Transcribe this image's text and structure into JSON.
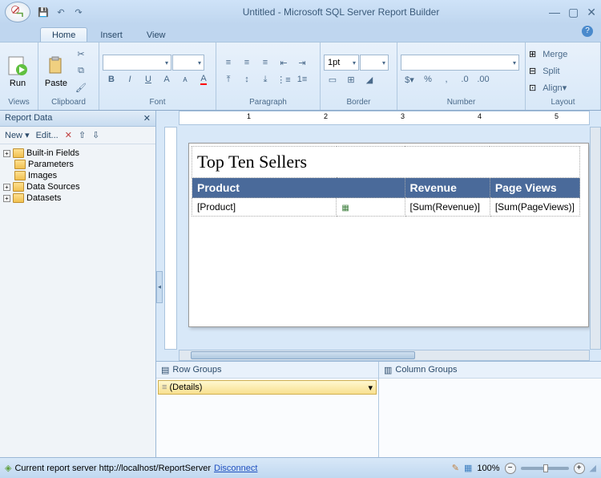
{
  "title": "Untitled - Microsoft SQL Server Report Builder",
  "qat": {
    "save": "💾",
    "undo": "↶",
    "redo": "↷"
  },
  "tabs": {
    "home": "Home",
    "insert": "Insert",
    "view": "View"
  },
  "ribbon": {
    "views": {
      "label": "Views",
      "run": "Run"
    },
    "clipboard": {
      "label": "Clipboard",
      "paste": "Paste"
    },
    "font": {
      "label": "Font",
      "bold": "B",
      "italic": "I",
      "underline": "U"
    },
    "paragraph": {
      "label": "Paragraph"
    },
    "border": {
      "label": "Border",
      "size": "1pt"
    },
    "number": {
      "label": "Number"
    },
    "layout": {
      "label": "Layout",
      "merge": "Merge",
      "split": "Split",
      "align": "Align"
    }
  },
  "reportData": {
    "title": "Report Data",
    "new": "New",
    "edit": "Edit...",
    "items": [
      "Built-in Fields",
      "Parameters",
      "Images",
      "Data Sources",
      "Datasets"
    ]
  },
  "report": {
    "title": "Top Ten Sellers",
    "cols": [
      "Product",
      "Revenue",
      "Page Views"
    ],
    "cells": [
      "[Product]",
      "[Sum(Revenue)]",
      "[Sum(PageViews)]"
    ]
  },
  "groups": {
    "row": "Row Groups",
    "col": "Column Groups",
    "details": "(Details)"
  },
  "status": {
    "server": "Current report server http://localhost/ReportServer",
    "disconnect": "Disconnect",
    "zoom": "100%"
  }
}
